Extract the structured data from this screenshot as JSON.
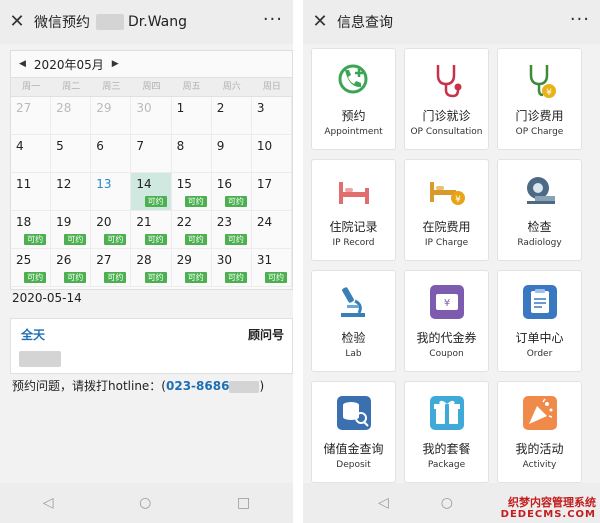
{
  "left": {
    "title": "微信预约",
    "title_name": "Dr.Wang",
    "more": "···",
    "close_glyph": "✕",
    "calendar": {
      "month": "2020年05月",
      "prev_glyph": "◀",
      "next_glyph": "▶",
      "weekdays": [
        "周一",
        "周二",
        "周三",
        "周四",
        "周五",
        "周六",
        "周日"
      ],
      "avail_label": "可约",
      "cells": [
        {
          "d": "27",
          "s": "grey"
        },
        {
          "d": "28",
          "s": "grey"
        },
        {
          "d": "29",
          "s": "grey"
        },
        {
          "d": "30",
          "s": "grey"
        },
        {
          "d": "1"
        },
        {
          "d": "2"
        },
        {
          "d": "3"
        },
        {
          "d": "4"
        },
        {
          "d": "5"
        },
        {
          "d": "6"
        },
        {
          "d": "7"
        },
        {
          "d": "8"
        },
        {
          "d": "9"
        },
        {
          "d": "10"
        },
        {
          "d": "11"
        },
        {
          "d": "12"
        },
        {
          "d": "13",
          "s": "blue"
        },
        {
          "d": "14",
          "s": "today",
          "a": true
        },
        {
          "d": "15",
          "a": true
        },
        {
          "d": "16",
          "a": true
        },
        {
          "d": "17"
        },
        {
          "d": "18",
          "a": true
        },
        {
          "d": "19",
          "a": true
        },
        {
          "d": "20",
          "a": true
        },
        {
          "d": "21",
          "a": true
        },
        {
          "d": "22",
          "a": true
        },
        {
          "d": "23",
          "a": true
        },
        {
          "d": "24"
        },
        {
          "d": "25",
          "a": true
        },
        {
          "d": "26",
          "a": true
        },
        {
          "d": "27",
          "a": true
        },
        {
          "d": "28",
          "a": true
        },
        {
          "d": "29",
          "a": true
        },
        {
          "d": "30",
          "a": true
        },
        {
          "d": "31",
          "a": true
        }
      ]
    },
    "selected_date": "2020-05-14",
    "card": {
      "all_day": "全天",
      "consultant": "顾问号"
    },
    "hotline_prefix": "预约问题，请拨打hotline：(",
    "hotline_number": "023-8686",
    "hotline_suffix": ")",
    "nav": {
      "back": "◁",
      "home": "○",
      "recent": "□"
    }
  },
  "right": {
    "title": "信息查询",
    "more": "···",
    "close_glyph": "✕",
    "tiles": [
      {
        "cn": "预约",
        "en": "Appointment",
        "icon": "phone-plus-icon"
      },
      {
        "cn": "门诊就诊",
        "en": "OP Consultation",
        "icon": "stethoscope-icon"
      },
      {
        "cn": "门诊费用",
        "en": "OP Charge",
        "icon": "stethoscope-yen-icon"
      },
      {
        "cn": "住院记录",
        "en": "IP Record",
        "icon": "hospital-bed-icon"
      },
      {
        "cn": "在院费用",
        "en": "IP Charge",
        "icon": "bed-yen-icon"
      },
      {
        "cn": "检查",
        "en": "Radiology",
        "icon": "ct-scanner-icon"
      },
      {
        "cn": "检验",
        "en": "Lab",
        "icon": "microscope-icon"
      },
      {
        "cn": "我的代金券",
        "en": "Coupon",
        "icon": "coupon-icon"
      },
      {
        "cn": "订单中心",
        "en": "Order",
        "icon": "clipboard-icon"
      },
      {
        "cn": "储值金查询",
        "en": "Deposit",
        "icon": "coins-search-icon"
      },
      {
        "cn": "我的套餐",
        "en": "Package",
        "icon": "gift-icon"
      },
      {
        "cn": "我的活动",
        "en": "Activity",
        "icon": "party-popper-icon"
      }
    ],
    "nav": {
      "back": "◁",
      "home": "○"
    }
  },
  "watermark": {
    "line1": "织梦内容管理系统",
    "line2": "DEDECMS.COM"
  },
  "colors": {
    "accent": "#1e6fb3",
    "available": "#4cb050",
    "today": "#cfe8e0"
  }
}
